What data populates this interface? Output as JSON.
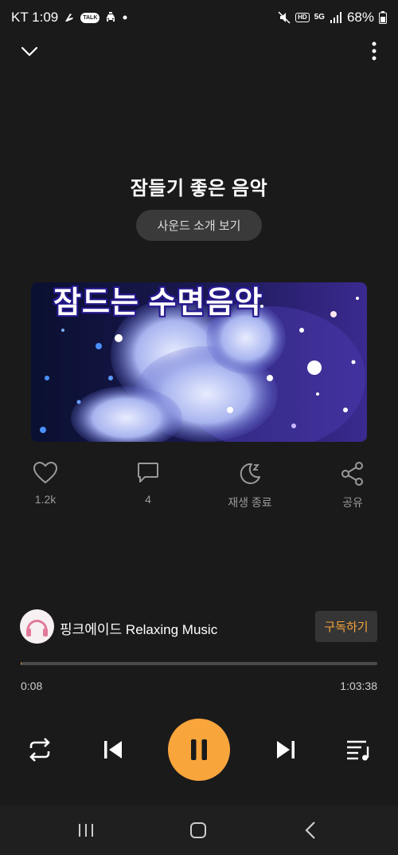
{
  "status_bar": {
    "carrier_time": "KT 1:09",
    "talk_badge": "TALK",
    "hd_badge": "HD",
    "network": "5G",
    "battery": "68%",
    "icons": [
      "drone-icon",
      "talk-bubble-icon",
      "car-icon",
      "dot-icon",
      "mute-icon",
      "hd-icon",
      "5g-icon",
      "signal-icon",
      "battery-icon"
    ]
  },
  "header": {
    "title": "잠들기 좋은 음악",
    "intro_button": "사운드 소개 보기"
  },
  "artwork": {
    "overlay_text": "잠드는 수면음악"
  },
  "actions": [
    {
      "name": "like",
      "icon": "heart-icon",
      "label": "1.2k"
    },
    {
      "name": "comment",
      "icon": "comment-icon",
      "label": "4"
    },
    {
      "name": "sleep-timer",
      "icon": "moon-zz-icon",
      "label": "재생 종료"
    },
    {
      "name": "share",
      "icon": "share-icon",
      "label": "공유"
    }
  ],
  "channel": {
    "name": "핑크에이드 Relaxing Music",
    "subscribe_label": "구독하기",
    "avatar_text": "Pink\naide"
  },
  "player": {
    "current_time": "0:08",
    "total_time": "1:03:38",
    "progress": 0.002,
    "icons": [
      "repeat-icon",
      "previous-icon",
      "pause-icon",
      "next-icon",
      "playlist-icon"
    ]
  },
  "colors": {
    "accent": "#f8a53c",
    "background": "#1a1a1a",
    "muted_text": "#9a9a9a"
  }
}
